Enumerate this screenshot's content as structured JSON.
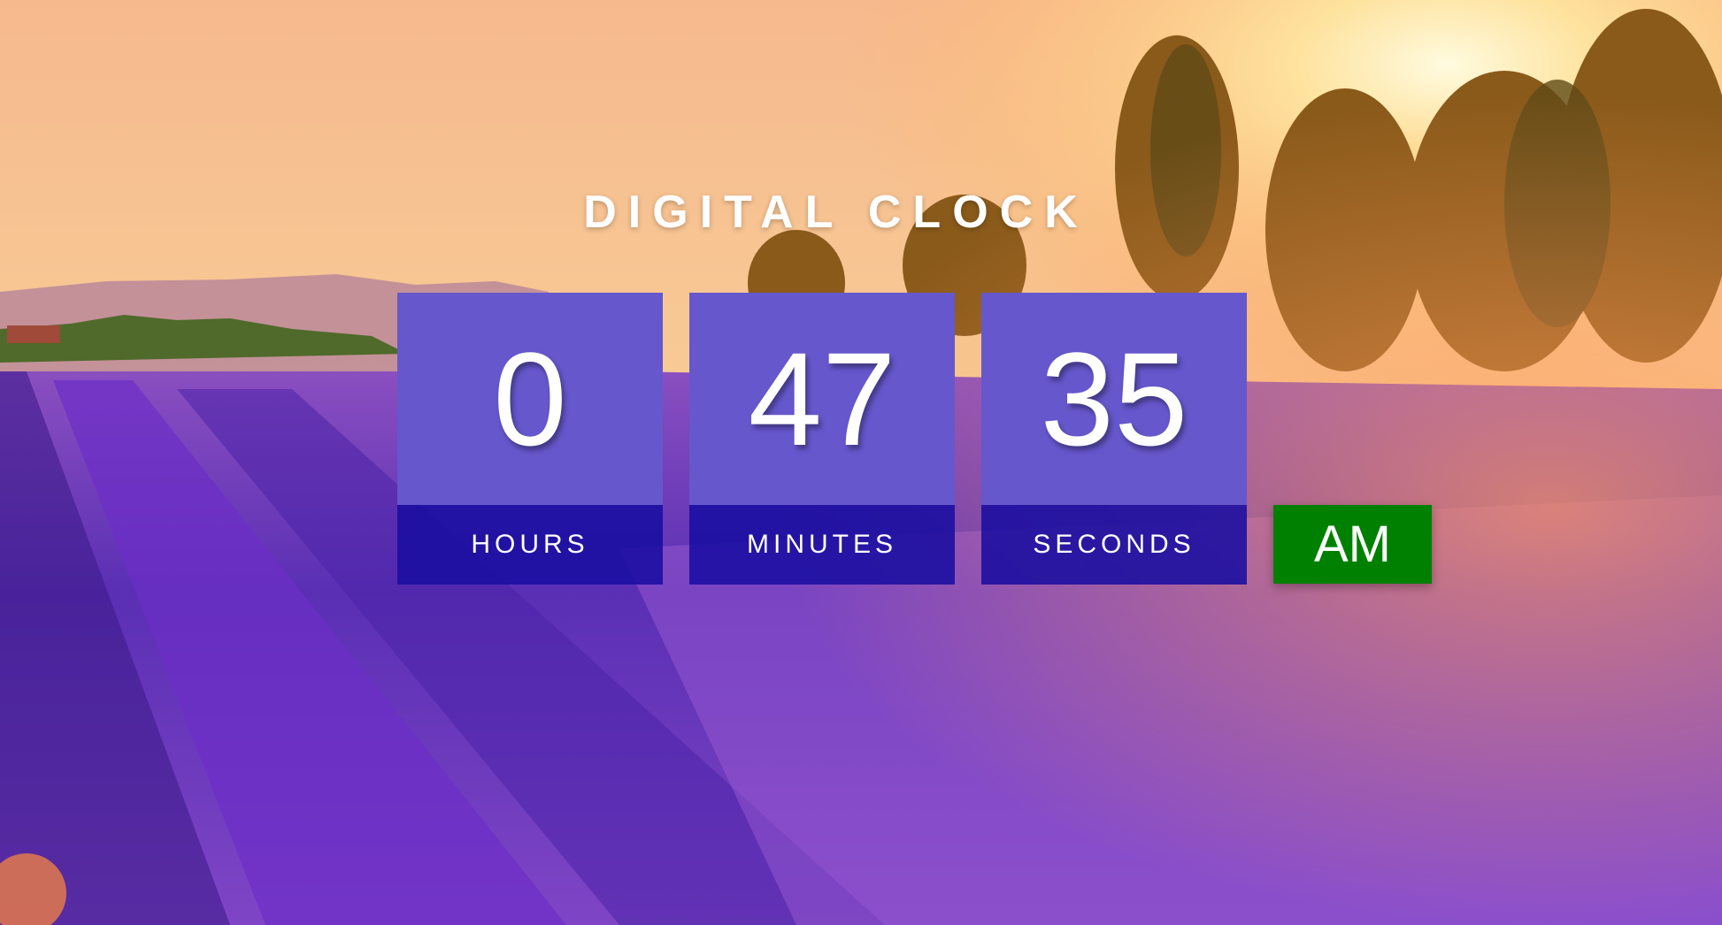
{
  "title": "DIGITAL CLOCK",
  "clock": {
    "hours": {
      "value": "0",
      "label": "HOURS"
    },
    "minutes": {
      "value": "47",
      "label": "MINUTES"
    },
    "seconds": {
      "value": "35",
      "label": "SECONDS"
    },
    "period": "AM"
  },
  "colors": {
    "digit_box": "#6657cc",
    "label_box": "#1a0ea0",
    "period_badge": "#008000",
    "text": "#ffffff"
  }
}
